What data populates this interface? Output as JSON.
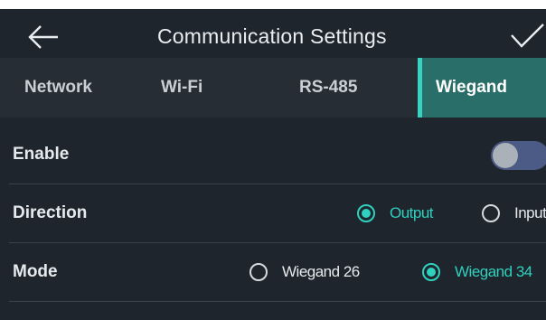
{
  "header": {
    "title": "Communication Settings",
    "back_icon": "arrow-left-icon",
    "confirm_icon": "checkmark-icon"
  },
  "tabs": [
    {
      "label": "Network",
      "active": false
    },
    {
      "label": "Wi-Fi",
      "active": false
    },
    {
      "label": "RS-485",
      "active": false
    },
    {
      "label": "Wiegand",
      "active": true
    }
  ],
  "settings": {
    "enable": {
      "label": "Enable",
      "on": false
    },
    "direction": {
      "label": "Direction",
      "options": [
        {
          "label": "Output",
          "selected": true
        },
        {
          "label": "Input",
          "selected": false
        }
      ]
    },
    "mode": {
      "label": "Mode",
      "options": [
        {
          "label": "Wiegand 26",
          "selected": false
        },
        {
          "label": "Wiegand 34",
          "selected": true
        }
      ]
    }
  },
  "colors": {
    "background": "#1f252c",
    "tab_bar": "#262d34",
    "active_tab": "#2a6e69",
    "accent": "#2fd0be",
    "toggle_track": "#4c5a86"
  }
}
